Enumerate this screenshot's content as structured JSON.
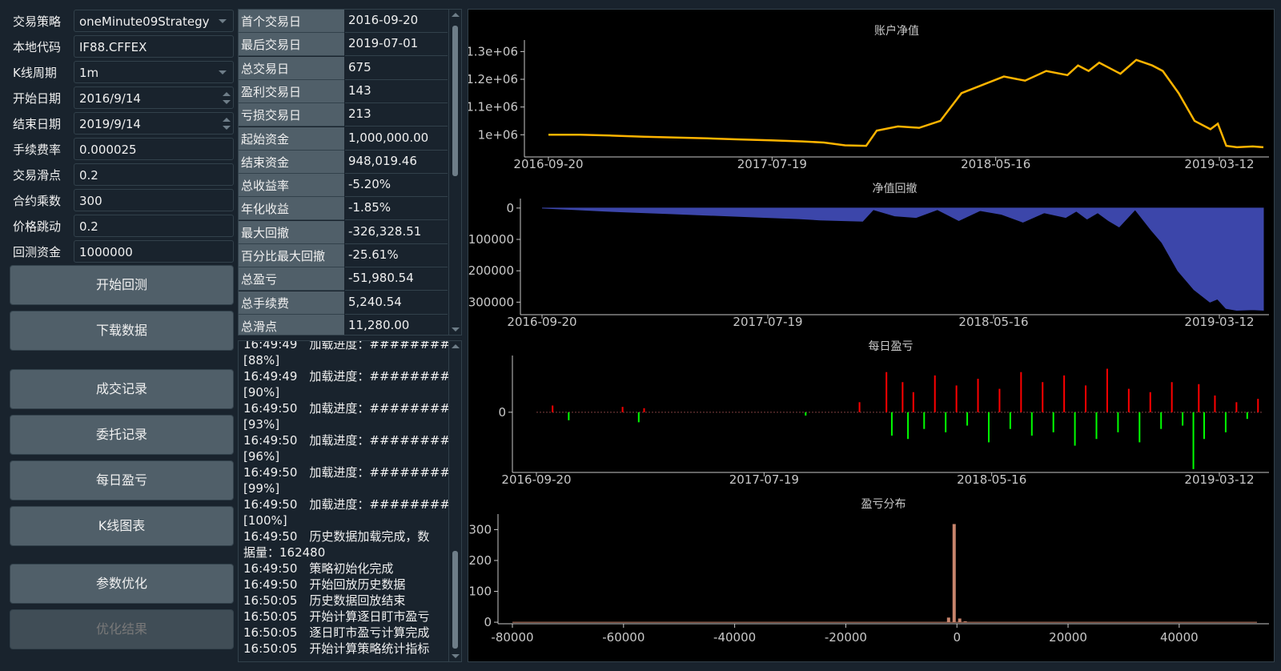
{
  "settings": {
    "fields": [
      {
        "label": "交易策略",
        "value": "oneMinute09Strategy",
        "kind": "combo"
      },
      {
        "label": "本地代码",
        "value": "IF88.CFFEX",
        "kind": "text"
      },
      {
        "label": "K线周期",
        "value": "1m",
        "kind": "combo"
      },
      {
        "label": "开始日期",
        "value": "2016/9/14",
        "kind": "date"
      },
      {
        "label": "结束日期",
        "value": "2019/9/14",
        "kind": "date"
      },
      {
        "label": "手续费率",
        "value": "0.000025",
        "kind": "text"
      },
      {
        "label": "交易滑点",
        "value": "0.2",
        "kind": "text"
      },
      {
        "label": "合约乘数",
        "value": "300",
        "kind": "text"
      },
      {
        "label": "价格跳动",
        "value": "0.2",
        "kind": "text"
      },
      {
        "label": "回测资金",
        "value": "1000000",
        "kind": "text"
      }
    ],
    "buttons": {
      "start_backtest": "开始回测",
      "download_data": "下载数据",
      "trade_records": "成交记录",
      "order_records": "委托记录",
      "daily_pnl": "每日盈亏",
      "kline_chart": "K线图表",
      "param_optimize": "参数优化",
      "optimize_result": "优化结果"
    }
  },
  "statistics": [
    {
      "key": "首个交易日",
      "value": "2016-09-20"
    },
    {
      "key": "最后交易日",
      "value": "2019-07-01"
    },
    {
      "key": "总交易日",
      "value": "675"
    },
    {
      "key": "盈利交易日",
      "value": "143"
    },
    {
      "key": "亏损交易日",
      "value": "213"
    },
    {
      "key": "起始资金",
      "value": "1,000,000.00"
    },
    {
      "key": "结束资金",
      "value": "948,019.46"
    },
    {
      "key": "总收益率",
      "value": "-5.20%"
    },
    {
      "key": "年化收益",
      "value": "-1.85%"
    },
    {
      "key": "最大回撤",
      "value": "-326,328.51"
    },
    {
      "key": "百分比最大回撤",
      "value": "-25.61%"
    },
    {
      "key": "总盈亏",
      "value": "-51,980.54"
    },
    {
      "key": "总手续费",
      "value": "5,240.54"
    },
    {
      "key": "总滑点",
      "value": "11,280.00"
    }
  ],
  "log": [
    "16:49:49　加载进度：#########",
    "[88%]",
    "16:49:49　加载进度：#########",
    "[90%]",
    "16:49:50　加载进度：#########",
    "[93%]",
    "16:49:50　加载进度：#########",
    "[96%]",
    "16:49:50　加载进度：#########",
    "[99%]",
    "16:49:50　加载进度：##########",
    "[100%]",
    "16:49:50　历史数据加载完成，数",
    "据量：162480",
    "16:49:50　策略初始化完成",
    "16:49:50　开始回放历史数据",
    "16:50:05　历史数据回放结束",
    "16:50:05　开始计算逐日盯市盈亏",
    "16:50:05　逐日盯市盈亏计算完成",
    "16:50:05　开始计算策略统计指标"
  ],
  "colors": {
    "balance_line": "#ffb400",
    "drawdown_fill": "#3c46aa",
    "profit_bar": "#ff0000",
    "loss_bar": "#00ff00",
    "histogram": "#c8846c"
  },
  "chart_data": [
    {
      "type": "line",
      "title": "账户净值",
      "xlabel": "",
      "ylabel": "",
      "x_ticks": [
        "2016-09-20",
        "2017-07-19",
        "2018-05-16",
        "2019-03-12"
      ],
      "y_ticks": [
        "1e+06",
        "1.1e+06",
        "1.2e+06",
        "1.3e+06"
      ],
      "ylim": [
        920000,
        1330000
      ],
      "series": [
        {
          "x": [
            0,
            30,
            60,
            90,
            120,
            150,
            180,
            210,
            240,
            260,
            280,
            300,
            310,
            330,
            350,
            370,
            390,
            410,
            430,
            450,
            470,
            490,
            500,
            510,
            520,
            530,
            540,
            555,
            570,
            580,
            595,
            610,
            625,
            632,
            640,
            650,
            665,
            675
          ],
          "y": [
            1000000,
            1000000,
            997000,
            993000,
            990000,
            987000,
            983000,
            980000,
            976000,
            972000,
            962000,
            960000,
            1015000,
            1030000,
            1025000,
            1050000,
            1150000,
            1180000,
            1210000,
            1195000,
            1230000,
            1215000,
            1250000,
            1230000,
            1260000,
            1240000,
            1220000,
            1270000,
            1250000,
            1230000,
            1150000,
            1050000,
            1020000,
            1040000,
            960000,
            955000,
            958000,
            955000
          ]
        }
      ]
    },
    {
      "type": "area",
      "title": "净值回撤",
      "xlabel": "",
      "ylabel": "",
      "x_ticks": [
        "2016-09-20",
        "2017-07-19",
        "2018-05-16",
        "2019-03-12"
      ],
      "y_ticks": [
        "0",
        "-100000",
        "-200000",
        "-300000"
      ],
      "ylim": [
        -340000,
        20000
      ],
      "series": [
        {
          "x": [
            0,
            30,
            60,
            90,
            120,
            150,
            180,
            210,
            240,
            260,
            280,
            300,
            310,
            330,
            350,
            370,
            390,
            410,
            430,
            450,
            470,
            490,
            500,
            510,
            520,
            530,
            540,
            555,
            570,
            580,
            595,
            610,
            625,
            632,
            640,
            650,
            665,
            675
          ],
          "y": [
            0,
            -5000,
            -10000,
            -14000,
            -18000,
            -22000,
            -26000,
            -30000,
            -34000,
            -38000,
            -40000,
            -42000,
            -5000,
            -25000,
            -30000,
            -5000,
            -40000,
            -8000,
            -20000,
            -45000,
            -15000,
            -30000,
            -10000,
            -35000,
            -15000,
            -40000,
            -60000,
            -5000,
            -70000,
            -110000,
            -200000,
            -260000,
            -300000,
            -290000,
            -320000,
            -326000,
            -324000,
            -326000
          ]
        }
      ]
    },
    {
      "type": "bar",
      "title": "每日盈亏",
      "xlabel": "",
      "ylabel": "",
      "x_ticks": [
        "2016-09-20",
        "2017-07-19",
        "2018-05-16",
        "2019-03-12"
      ],
      "y_ticks": [
        "0"
      ],
      "ylim": [
        -90000,
        80000
      ],
      "series": [
        {
          "x": [
            15,
            30,
            80,
            95,
            100,
            250,
            300,
            325,
            330,
            340,
            345,
            350,
            360,
            370,
            380,
            390,
            400,
            410,
            420,
            430,
            440,
            450,
            460,
            470,
            480,
            490,
            500,
            510,
            520,
            530,
            540,
            550,
            560,
            570,
            580,
            590,
            600,
            610,
            615,
            620,
            630,
            640,
            650,
            660,
            670
          ],
          "y": [
            10000,
            -12000,
            8000,
            -15000,
            6000,
            -5000,
            15000,
            60000,
            -35000,
            45000,
            -40000,
            30000,
            -25000,
            55000,
            -30000,
            40000,
            -20000,
            50000,
            -45000,
            35000,
            -25000,
            60000,
            -35000,
            45000,
            -30000,
            55000,
            -50000,
            40000,
            -40000,
            65000,
            -30000,
            35000,
            -45000,
            30000,
            -25000,
            45000,
            -20000,
            -85000,
            42000,
            -40000,
            25000,
            -30000,
            15000,
            -10000,
            20000
          ]
        }
      ]
    },
    {
      "type": "bar",
      "title": "盈亏分布",
      "xlabel": "",
      "ylabel": "",
      "x_ticks": [
        "-80000",
        "-60000",
        "-40000",
        "-20000",
        "0",
        "20000",
        "40000"
      ],
      "y_ticks": [
        "0",
        "100",
        "200",
        "300"
      ],
      "xlim": [
        -80000,
        54000
      ],
      "ylim": [
        -5,
        340
      ],
      "categories": [
        -1500,
        -500,
        500,
        1500
      ],
      "values": [
        15,
        318,
        12,
        3
      ]
    }
  ]
}
